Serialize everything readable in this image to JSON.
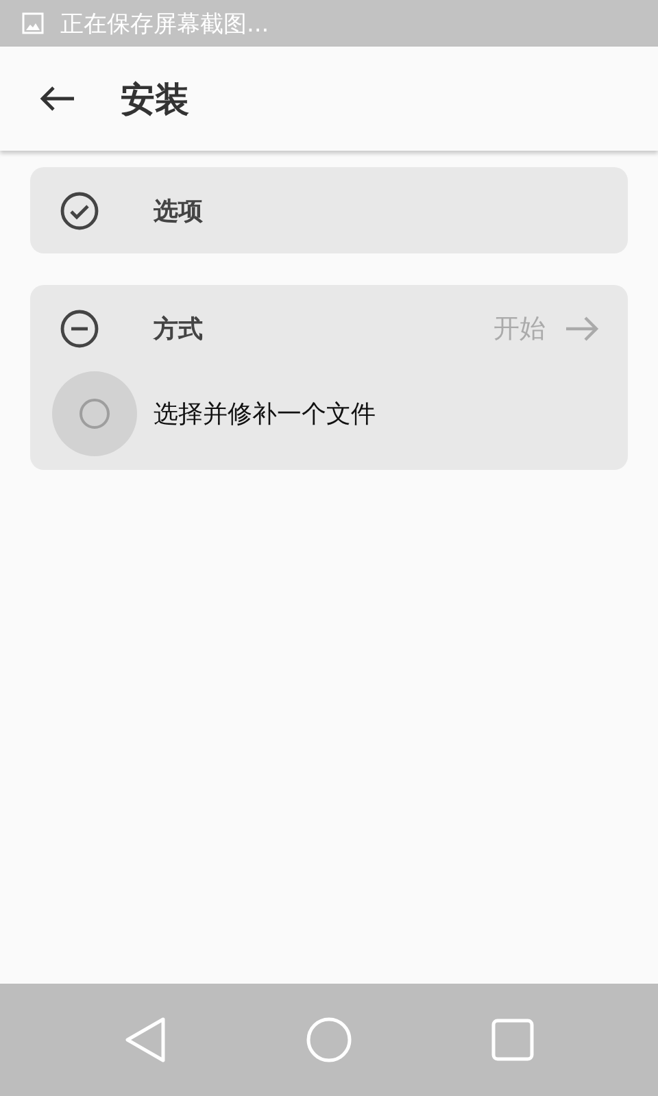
{
  "status_bar": {
    "text": "正在保存屏幕截图..."
  },
  "app_bar": {
    "title": "安装"
  },
  "steps": [
    {
      "kind": "done",
      "title": "选项"
    },
    {
      "kind": "active",
      "title": "方式",
      "action": "开始",
      "options": [
        {
          "label": "选择并修补一个文件",
          "selected": false,
          "pressed": true
        }
      ]
    }
  ]
}
